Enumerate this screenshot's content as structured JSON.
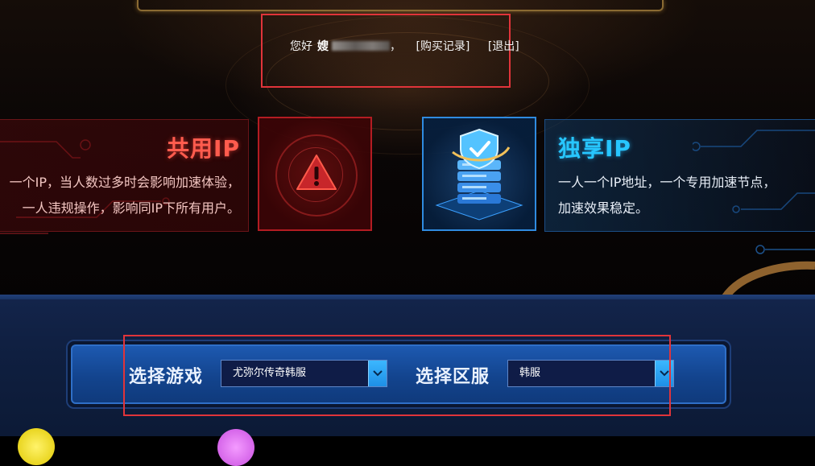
{
  "header": {
    "greeting": "您好",
    "username_masked": "嫂",
    "comma": "，",
    "purchase_link": "[购买记录]",
    "logout_link": "[退出]"
  },
  "shared_ip": {
    "title": "共用IP",
    "line1": "一个IP，当人数过多时会影响加速体验，",
    "line2": "一人违规操作，影响同IP下所有用户。",
    "icon": "warning-triangle-icon"
  },
  "exclusive_ip": {
    "title": "独享IP",
    "line1": "一人一个IP地址，一个专用加速节点，",
    "line2": "加速效果稳定。",
    "icon": "server-shield-icon"
  },
  "selector": {
    "game_label": "选择游戏",
    "game_value": "尤弥尔传奇韩服",
    "region_label": "选择区服",
    "region_value": "韩服"
  },
  "colors": {
    "highlight_box": "#e0343a",
    "shared_title": "#ff5c4e",
    "exclusive_title": "#27c6ff",
    "panel_blue": "#1d59b0"
  }
}
